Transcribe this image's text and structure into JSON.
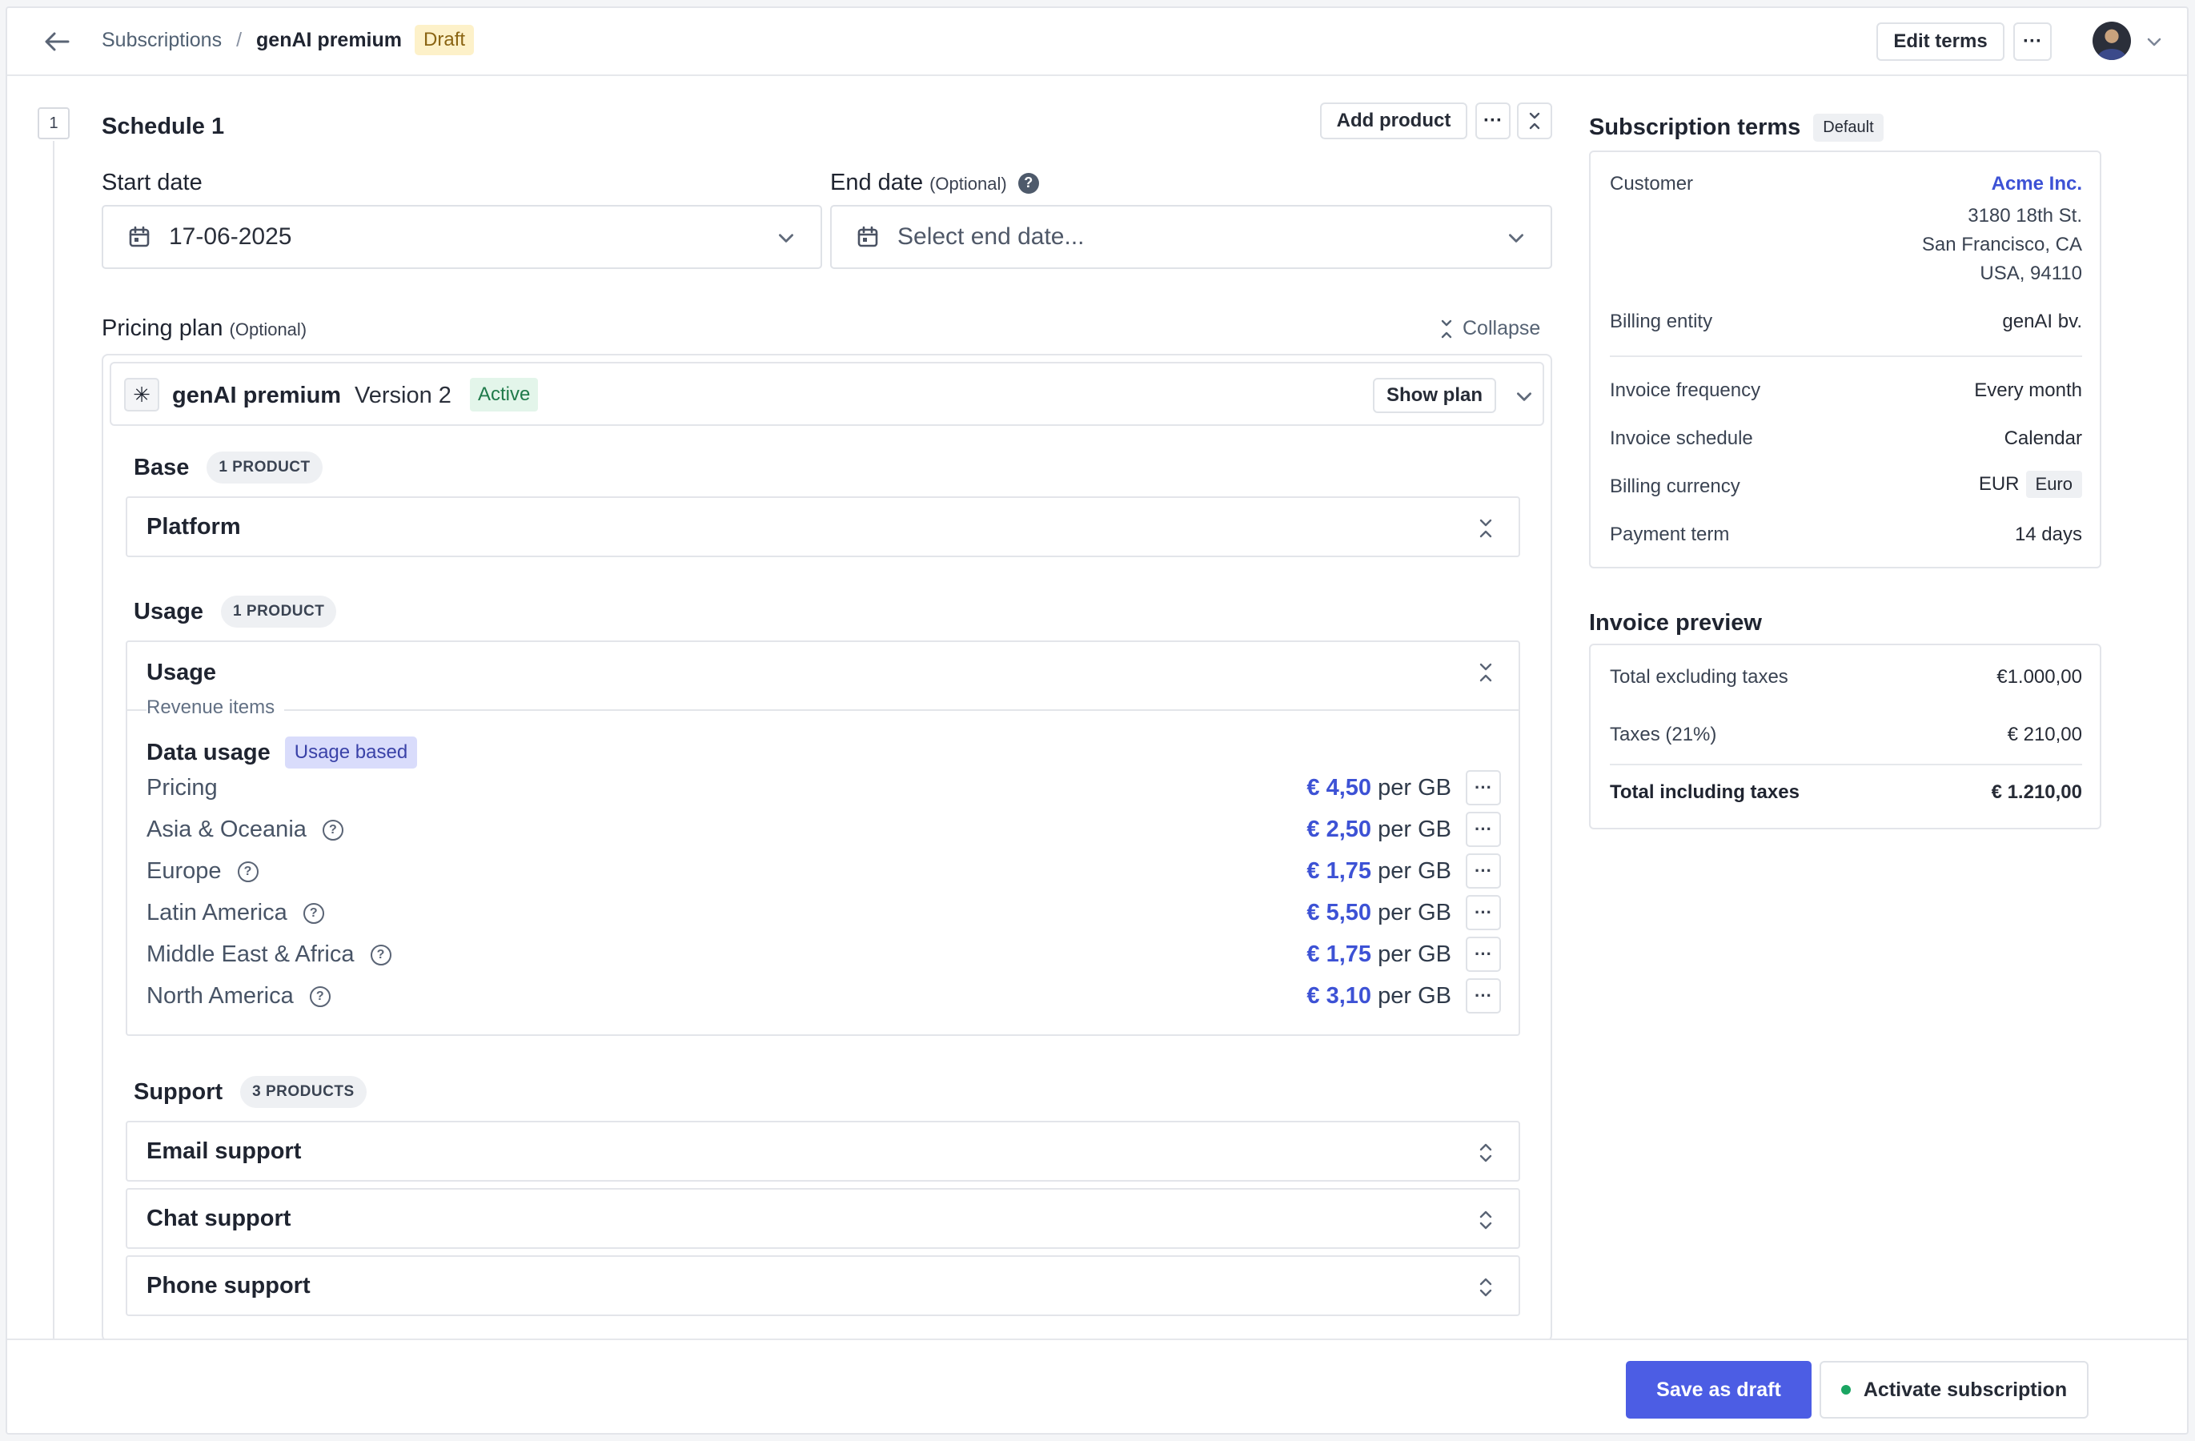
{
  "header": {
    "breadcrumb_parent": "Subscriptions",
    "breadcrumb_separator": "/",
    "breadcrumb_current": "genAI premium",
    "status_badge": "Draft",
    "edit_terms_label": "Edit terms",
    "more_label": "···"
  },
  "schedule": {
    "number": "1",
    "title": "Schedule 1",
    "add_product_label": "Add product",
    "more_label": "···",
    "start_date_label": "Start date",
    "start_date_value": "17-06-2025",
    "end_date_label": "End date",
    "end_date_optional": "(Optional)",
    "end_date_help": "?",
    "end_date_placeholder": "Select end date...",
    "pricing_plan_label": "Pricing plan",
    "pricing_plan_optional": "(Optional)",
    "collapse_label": "Collapse"
  },
  "plan": {
    "icon_glyph": "✳",
    "name": "genAI premium",
    "version": "Version 2",
    "status": "Active",
    "show_plan_label": "Show plan",
    "sections": {
      "base": {
        "title": "Base",
        "count": "1 PRODUCT",
        "products": [
          "Platform"
        ]
      },
      "usage": {
        "title": "Usage",
        "count": "1 PRODUCT",
        "product_title": "Usage",
        "revenue_items_label": "Revenue items",
        "item_name": "Data usage",
        "item_badge": "Usage based",
        "price_rows": [
          {
            "name": "Pricing",
            "amount": "€ 4,50",
            "unit": "per GB",
            "help": false
          },
          {
            "name": "Asia & Oceania",
            "amount": "€ 2,50",
            "unit": "per GB",
            "help": true
          },
          {
            "name": "Europe",
            "amount": "€ 1,75",
            "unit": "per GB",
            "help": true
          },
          {
            "name": "Latin America",
            "amount": "€ 5,50",
            "unit": "per GB",
            "help": true
          },
          {
            "name": "Middle East & Africa",
            "amount": "€ 1,75",
            "unit": "per GB",
            "help": true
          },
          {
            "name": "North America",
            "amount": "€ 3,10",
            "unit": "per GB",
            "help": true
          }
        ]
      },
      "support": {
        "title": "Support",
        "count": "3 PRODUCTS",
        "products": [
          "Email support",
          "Chat support",
          "Phone support"
        ]
      }
    }
  },
  "terms": {
    "title": "Subscription terms",
    "badge": "Default",
    "customer_label": "Customer",
    "customer_name": "Acme Inc.",
    "address_line1": "3180 18th St.",
    "address_line2": "San Francisco, CA",
    "address_line3": "USA, 94110",
    "billing_entity_label": "Billing entity",
    "billing_entity_value": "genAI bv.",
    "invoice_frequency_label": "Invoice frequency",
    "invoice_frequency_value": "Every month",
    "invoice_schedule_label": "Invoice schedule",
    "invoice_schedule_value": "Calendar",
    "billing_currency_label": "Billing currency",
    "billing_currency_code": "EUR",
    "billing_currency_name": "Euro",
    "payment_term_label": "Payment term",
    "payment_term_value": "14 days"
  },
  "invoice": {
    "title": "Invoice preview",
    "excl_label": "Total excluding taxes",
    "excl_value": "€1.000,00",
    "tax_label": "Taxes (21%)",
    "tax_value": "€ 210,00",
    "incl_label": "Total including taxes",
    "incl_value": "€ 1.210,00"
  },
  "footer": {
    "save_draft_label": "Save as draft",
    "activate_label": "Activate subscription"
  },
  "colors": {
    "accent": "#4c5de4",
    "link": "#3d52d5",
    "draft_bg": "#fdf1c9",
    "active_bg": "#e3f5ea",
    "usage_badge_bg": "#d9dcfb",
    "status_dot": "#1aa562"
  },
  "icons": [
    "back-arrow-icon",
    "chevron-down-icon",
    "calendar-icon",
    "help-icon",
    "collapse-icon",
    "expand-toggle-icon",
    "more-icon",
    "plan-asterisk-icon",
    "status-dot-icon"
  ]
}
